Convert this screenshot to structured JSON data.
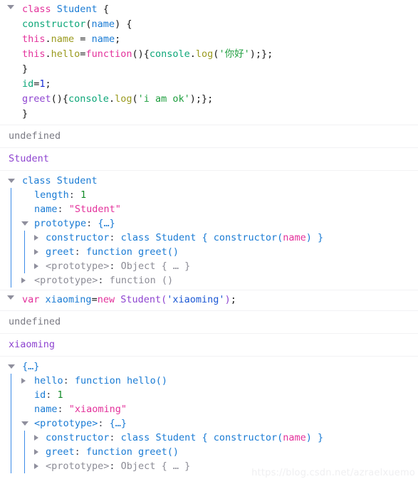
{
  "app": {
    "name": "firefox-devtools-console",
    "watermark": "https://blog.csdn.net/azraelxuemo"
  },
  "colors": {
    "keyword": "#e3319b",
    "class_blue": "#1a7bd4",
    "class_violet": "#8e44d0",
    "function_teal": "#0ca678",
    "property_olive": "#9a9a1e",
    "string_green": "#1e9e3e",
    "string_blue": "#1a57d4",
    "number_navy": "#1a2fd4",
    "undefined_gray": "#7a7a83",
    "object_key": "#1a7bd4",
    "object_number": "#128b28",
    "object_string": "#e3319b",
    "object_gray": "#8c8c96",
    "rail": "#3c8ce8",
    "separator": "#f2f2f4",
    "background": "#ffffff"
  },
  "entries": [
    {
      "kind": "command",
      "name": "class-student-declaration",
      "lines": [
        [
          {
            "t": "class",
            "c": "kw"
          },
          {
            "t": " ",
            "c": "punct"
          },
          {
            "t": "Student",
            "c": "cls"
          },
          {
            "t": " {",
            "c": "punct"
          }
        ],
        [
          {
            "t": "constructor",
            "c": "fn"
          },
          {
            "t": "(",
            "c": "punct"
          },
          {
            "t": "name",
            "c": "ident"
          },
          {
            "t": ") {",
            "c": "punct"
          }
        ],
        [
          {
            "t": "this",
            "c": "kw"
          },
          {
            "t": ".",
            "c": "punct"
          },
          {
            "t": "name",
            "c": "prop-ol"
          },
          {
            "t": " = ",
            "c": "punct"
          },
          {
            "t": "name",
            "c": "ident"
          },
          {
            "t": ";",
            "c": "punct"
          }
        ],
        [
          {
            "t": "this",
            "c": "kw"
          },
          {
            "t": ".",
            "c": "punct"
          },
          {
            "t": "hello",
            "c": "prop-ol"
          },
          {
            "t": "=",
            "c": "punct"
          },
          {
            "t": "function",
            "c": "kw"
          },
          {
            "t": "(){",
            "c": "punct"
          },
          {
            "t": "console",
            "c": "fn"
          },
          {
            "t": ".",
            "c": "punct"
          },
          {
            "t": "log",
            "c": "prop-ol"
          },
          {
            "t": "(",
            "c": "punct"
          },
          {
            "t": "'你好'",
            "c": "str-green"
          },
          {
            "t": ");};",
            "c": "punct"
          }
        ],
        [
          {
            "t": "}",
            "c": "punct"
          }
        ],
        [
          {
            "t": "id",
            "c": "fn"
          },
          {
            "t": "=",
            "c": "punct"
          },
          {
            "t": "1",
            "c": "num-navy"
          },
          {
            "t": ";",
            "c": "punct"
          }
        ],
        [
          {
            "t": "greet",
            "c": "meth"
          },
          {
            "t": "(){",
            "c": "punct"
          },
          {
            "t": "console",
            "c": "fn"
          },
          {
            "t": ".",
            "c": "punct"
          },
          {
            "t": "log",
            "c": "prop-ol"
          },
          {
            "t": "(",
            "c": "punct"
          },
          {
            "t": "'i am ok'",
            "c": "str-green"
          },
          {
            "t": ");};",
            "c": "punct"
          }
        ],
        [
          {
            "t": "}",
            "c": "punct"
          }
        ]
      ]
    },
    {
      "kind": "result",
      "name": "result-undefined-1",
      "text": "undefined",
      "cls": "undef"
    },
    {
      "kind": "result",
      "name": "log-output-student",
      "text": "Student",
      "cls": "logout"
    },
    {
      "kind": "tree",
      "name": "class-student-inspector",
      "nodes": [
        {
          "level": 0,
          "twisty": "open",
          "name": "tree-root-class-student",
          "parts": [
            {
              "t": "class Student",
              "c": "o-key"
            }
          ]
        },
        {
          "level": 1,
          "twisty": "none",
          "name": "tree-row-length",
          "parts": [
            {
              "t": "length",
              "c": "o-key"
            },
            {
              "t": ": ",
              "c": "o-punct"
            },
            {
              "t": "1",
              "c": "o-num"
            }
          ]
        },
        {
          "level": 1,
          "twisty": "none",
          "name": "tree-row-name",
          "parts": [
            {
              "t": "name",
              "c": "o-key"
            },
            {
              "t": ": ",
              "c": "o-punct"
            },
            {
              "t": "\"Student\"",
              "c": "o-str"
            }
          ]
        },
        {
          "level": 1,
          "twisty": "open",
          "name": "tree-row-prototype",
          "parts": [
            {
              "t": "prototype",
              "c": "o-key"
            },
            {
              "t": ": ",
              "c": "o-punct"
            },
            {
              "t": "{…}",
              "c": "o-key"
            }
          ]
        },
        {
          "level": 2,
          "twisty": "closed",
          "name": "tree-row-constructor",
          "parts": [
            {
              "t": "constructor",
              "c": "o-key"
            },
            {
              "t": ": ",
              "c": "o-punct"
            },
            {
              "t": "class Student { constructor(",
              "c": "o-fnkw"
            },
            {
              "t": "name",
              "c": "o-pink"
            },
            {
              "t": ") }",
              "c": "o-fnkw"
            }
          ]
        },
        {
          "level": 2,
          "twisty": "closed",
          "name": "tree-row-greet",
          "parts": [
            {
              "t": "greet",
              "c": "o-key"
            },
            {
              "t": ": ",
              "c": "o-punct"
            },
            {
              "t": "function greet()",
              "c": "o-fnkw"
            }
          ]
        },
        {
          "level": 2,
          "twisty": "closed",
          "name": "tree-row-proto-object",
          "parts": [
            {
              "t": "<prototype>",
              "c": "o-gray"
            },
            {
              "t": ": ",
              "c": "o-punct"
            },
            {
              "t": "Object { … }",
              "c": "o-gray"
            }
          ]
        },
        {
          "level": 1,
          "twisty": "closed",
          "name": "tree-row-proto-function",
          "parts": [
            {
              "t": "<prototype>",
              "c": "o-gray"
            },
            {
              "t": ": ",
              "c": "o-punct"
            },
            {
              "t": "function ()",
              "c": "o-gray"
            }
          ]
        }
      ]
    },
    {
      "kind": "command",
      "name": "var-xiaoming-declaration",
      "lines": [
        [
          {
            "t": "var",
            "c": "kw"
          },
          {
            "t": " ",
            "c": "punct"
          },
          {
            "t": "xiaoming",
            "c": "ident"
          },
          {
            "t": "=",
            "c": "punct"
          },
          {
            "t": "new",
            "c": "kw"
          },
          {
            "t": " ",
            "c": "punct"
          },
          {
            "t": "Student",
            "c": "cls-v"
          },
          {
            "t": "(",
            "c": "paren-p"
          },
          {
            "t": "'xiaoming'",
            "c": "str-blue"
          },
          {
            "t": ")",
            "c": "paren-p"
          },
          {
            "t": ";",
            "c": "punct"
          }
        ]
      ]
    },
    {
      "kind": "result",
      "name": "result-undefined-2",
      "text": "undefined",
      "cls": "undef"
    },
    {
      "kind": "result",
      "name": "log-output-xiaoming",
      "text": "xiaoming",
      "cls": "logout"
    },
    {
      "kind": "tree",
      "name": "xiaoming-instance-inspector",
      "nodes": [
        {
          "level": 0,
          "twisty": "open",
          "name": "tree-root-object",
          "parts": [
            {
              "t": "{…}",
              "c": "o-key"
            }
          ]
        },
        {
          "level": 1,
          "twisty": "closed",
          "name": "tree-row-hello",
          "parts": [
            {
              "t": "hello",
              "c": "o-key"
            },
            {
              "t": ": ",
              "c": "o-punct"
            },
            {
              "t": "function hello()",
              "c": "o-fnkw"
            }
          ]
        },
        {
          "level": 1,
          "twisty": "none",
          "name": "tree-row-id",
          "parts": [
            {
              "t": "id",
              "c": "o-key"
            },
            {
              "t": ": ",
              "c": "o-punct"
            },
            {
              "t": "1",
              "c": "o-num"
            }
          ]
        },
        {
          "level": 1,
          "twisty": "none",
          "name": "tree-row-instance-name",
          "parts": [
            {
              "t": "name",
              "c": "o-key"
            },
            {
              "t": ": ",
              "c": "o-punct"
            },
            {
              "t": "\"xiaoming\"",
              "c": "o-str"
            }
          ]
        },
        {
          "level": 1,
          "twisty": "open",
          "name": "tree-row-instance-prototype",
          "parts": [
            {
              "t": "<prototype>",
              "c": "o-key"
            },
            {
              "t": ": ",
              "c": "o-punct"
            },
            {
              "t": "{…}",
              "c": "o-key"
            }
          ]
        },
        {
          "level": 2,
          "twisty": "closed",
          "name": "tree-row-instance-constructor",
          "parts": [
            {
              "t": "constructor",
              "c": "o-key"
            },
            {
              "t": ": ",
              "c": "o-punct"
            },
            {
              "t": "class Student { constructor(",
              "c": "o-fnkw"
            },
            {
              "t": "name",
              "c": "o-pink"
            },
            {
              "t": ") }",
              "c": "o-fnkw"
            }
          ]
        },
        {
          "level": 2,
          "twisty": "closed",
          "name": "tree-row-instance-greet",
          "parts": [
            {
              "t": "greet",
              "c": "o-key"
            },
            {
              "t": ": ",
              "c": "o-punct"
            },
            {
              "t": "function greet()",
              "c": "o-fnkw"
            }
          ]
        },
        {
          "level": 2,
          "twisty": "closed",
          "name": "tree-row-instance-proto-object",
          "parts": [
            {
              "t": "<prototype>",
              "c": "o-gray"
            },
            {
              "t": ": ",
              "c": "o-punct"
            },
            {
              "t": "Object { … }",
              "c": "o-gray"
            }
          ]
        }
      ]
    }
  ]
}
